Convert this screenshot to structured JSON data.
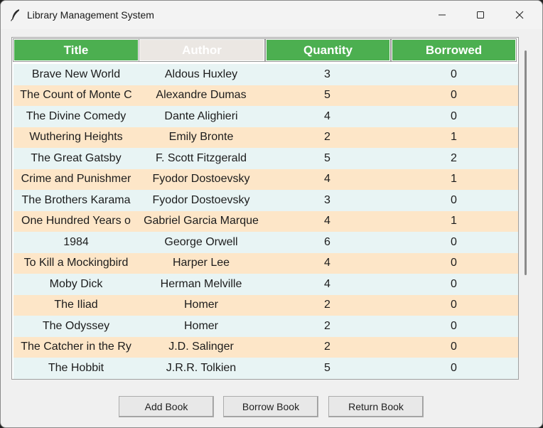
{
  "window": {
    "title": "Library Management System"
  },
  "table": {
    "headers": {
      "title": "Title",
      "author": "Author",
      "quantity": "Quantity",
      "borrowed": "Borrowed"
    },
    "rows": [
      {
        "title": "Brave New World",
        "author": "Aldous Huxley",
        "quantity": "3",
        "borrowed": "0"
      },
      {
        "title": "The Count of Monte C",
        "author": "Alexandre Dumas",
        "quantity": "5",
        "borrowed": "0"
      },
      {
        "title": "The Divine Comedy",
        "author": "Dante Alighieri",
        "quantity": "4",
        "borrowed": "0"
      },
      {
        "title": "Wuthering Heights",
        "author": "Emily Bronte",
        "quantity": "2",
        "borrowed": "1"
      },
      {
        "title": "The Great Gatsby",
        "author": "F. Scott Fitzgerald",
        "quantity": "5",
        "borrowed": "2"
      },
      {
        "title": "Crime and Punishmer",
        "author": "Fyodor Dostoevsky",
        "quantity": "4",
        "borrowed": "1"
      },
      {
        "title": "The Brothers Karama",
        "author": "Fyodor Dostoevsky",
        "quantity": "3",
        "borrowed": "0"
      },
      {
        "title": "One Hundred Years o",
        "author": "Gabriel Garcia Marque",
        "quantity": "4",
        "borrowed": "1"
      },
      {
        "title": "1984",
        "author": "George Orwell",
        "quantity": "6",
        "borrowed": "0"
      },
      {
        "title": "To Kill a Mockingbird",
        "author": "Harper Lee",
        "quantity": "4",
        "borrowed": "0"
      },
      {
        "title": "Moby Dick",
        "author": "Herman Melville",
        "quantity": "4",
        "borrowed": "0"
      },
      {
        "title": "The Iliad",
        "author": "Homer",
        "quantity": "2",
        "borrowed": "0"
      },
      {
        "title": "The Odyssey",
        "author": "Homer",
        "quantity": "2",
        "borrowed": "0"
      },
      {
        "title": "The Catcher in the Ry",
        "author": "J.D. Salinger",
        "quantity": "2",
        "borrowed": "0"
      },
      {
        "title": "The Hobbit",
        "author": "J.R.R. Tolkien",
        "quantity": "5",
        "borrowed": "0"
      }
    ]
  },
  "buttons": {
    "add": "Add Book",
    "borrow": "Borrow Book",
    "return": "Return Book"
  },
  "colors": {
    "header_green": "#4caf50",
    "row_even": "#e8f4f4",
    "row_odd": "#fde6c8"
  }
}
